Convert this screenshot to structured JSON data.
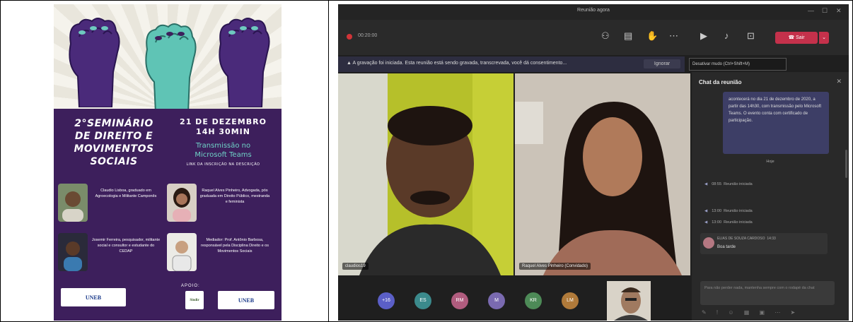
{
  "poster": {
    "title_lines": [
      "2°SEMINÁRIO",
      "DE DIREITO E",
      "MOVIMENTOS",
      "SOCIAIS"
    ],
    "date": "21 DE DEZEMBRO",
    "time": "14H 30MIN",
    "transmission_line1": "Transmissão no",
    "transmission_line2": "Microsoft Teams",
    "registration": "LINK DA INSCRIÇÃO NA DESCRIÇÃO",
    "speakers": [
      "Claudio Lisboa, graduado em Agroecologia e Militante Camponês",
      "Raquel Alves Pinheiro, Advogada, pós graduada em Direito Público, mestranda e feminista",
      "Josemir Ferreira, pesquisador, militante social e consultor e estudante do CEDAP",
      "Mediador: Prof. Antônio Barbosa, responsável pela Disciplina Direito e os Movimentos Sociais"
    ],
    "apoio": "APOIO:",
    "logo_left": "UNEB",
    "logo_mid": "Sindir",
    "logo_right": "UNEB"
  },
  "teams": {
    "window_title": "Reunião agora",
    "timer": "00:20:00",
    "leave_label": "Sair",
    "banner_text": "A gravação foi iniciada. Esta reunião está sendo gravada, transcrevada, você dá consentimento...",
    "ignore_label": "Ignorar",
    "tooltip": "Desativar mudo (Ctrl+Shift+M)",
    "chat_title": "Chat da reunião",
    "bubble_text": "acontecerá no dia 21 de dezembro de 2020, a partir das 14h30, com transmissão pelo Microsoft Teams. O evento conta com certificado de participação.",
    "today_label": "Hoje",
    "system_messages": [
      {
        "time": "08:55",
        "text": "Reunião iniciada"
      },
      {
        "time": "13:00",
        "text": "Reunião iniciada"
      },
      {
        "time": "13:00",
        "text": "Reunião iniciada"
      }
    ],
    "message_author": "ELIAS DE SOUZA CARDOSO",
    "message_time": "14:33",
    "message_text": "Boa tarde",
    "compose_placeholder": "Para não perder nada, mantenha sempre com o rodapé da chat",
    "left_video_label": "claudios19",
    "right_video_label": "Raquel Alves Pinheiro (Convidado)",
    "avatars": [
      {
        "label": "+16",
        "color": "#5b5fc7"
      },
      {
        "label": "ES",
        "color": "#3b8a8c"
      },
      {
        "label": "RM",
        "color": "#b05c7e"
      },
      {
        "label": "M",
        "color": "#7a6ab0"
      },
      {
        "label": "KR",
        "color": "#4d8a57"
      },
      {
        "label": "LM",
        "color": "#b07a3a"
      }
    ]
  }
}
